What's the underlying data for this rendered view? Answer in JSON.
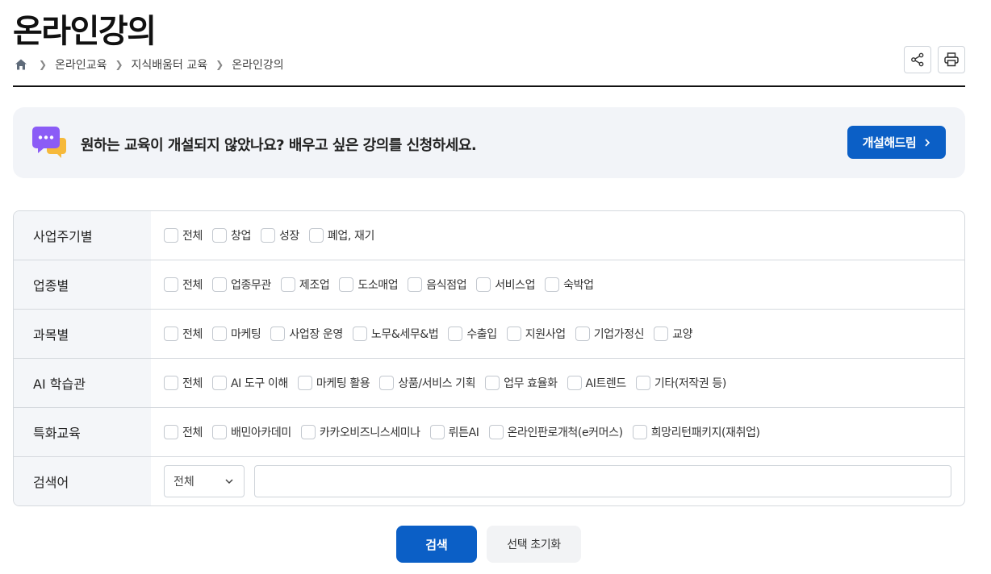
{
  "page": {
    "title": "온라인강의"
  },
  "breadcrumb": {
    "items": [
      "온라인교육",
      "지식배움터 교육",
      "온라인강의"
    ]
  },
  "banner": {
    "message": "원하는 교육이 개설되지 않았나요? 배우고 싶은 강의를 신청하세요.",
    "button_label": "개설해드림"
  },
  "filters": {
    "rows": [
      {
        "label": "사업주기별",
        "options": [
          "전체",
          "창업",
          "성장",
          "폐업, 재기"
        ]
      },
      {
        "label": "업종별",
        "options": [
          "전체",
          "업종무관",
          "제조업",
          "도소매업",
          "음식점업",
          "서비스업",
          "숙박업"
        ]
      },
      {
        "label": "과목별",
        "options": [
          "전체",
          "마케팅",
          "사업장 운영",
          "노무&세무&법",
          "수출입",
          "지원사업",
          "기업가정신",
          "교양"
        ]
      },
      {
        "label": "AI 학습관",
        "options": [
          "전체",
          "AI 도구 이해",
          "마케팅 활용",
          "상품/서비스 기획",
          "업무 효율화",
          "AI트렌드",
          "기타(저작권 등)"
        ]
      },
      {
        "label": "특화교육",
        "options": [
          "전체",
          "배민아카데미",
          "카카오비즈니스세미나",
          "뤼튼AI",
          "온라인판로개척(e커머스)",
          "희망리턴패키지(재취업)"
        ]
      }
    ],
    "keyword": {
      "label": "검색어",
      "select_value": "전체",
      "input_value": ""
    }
  },
  "actions": {
    "search_label": "검색",
    "reset_label": "선택 초기화"
  },
  "colors": {
    "primary": "#0b5fc6",
    "banner_bg": "#f2f4f8",
    "label_bg": "#f4f6f9",
    "border": "#d5d9de"
  },
  "icons": {
    "home": "home-icon",
    "share": "share-icon",
    "print": "print-icon",
    "chat": "chat-bubble-icon"
  }
}
